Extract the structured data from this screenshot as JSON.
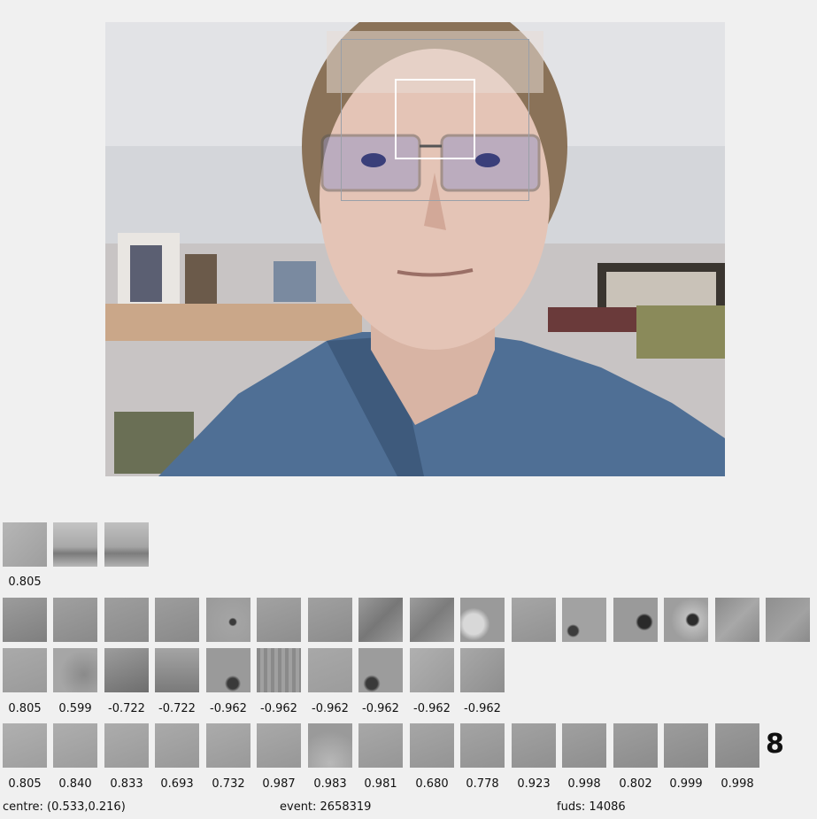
{
  "camera": {
    "label": "webcam view"
  },
  "row_a": {
    "thumbs": [
      {
        "shade": "#a8a8a8",
        "icon": "forehead-patch-icon"
      },
      {
        "shade": "#b8b8b8",
        "icon": "glasses-patch-icon"
      },
      {
        "shade": "#b4b4b4",
        "icon": "glasses-patch-icon"
      }
    ],
    "values": [
      "0.805"
    ]
  },
  "row_b": {
    "thumbs": [
      {
        "shade": "#8e8e8e"
      },
      {
        "shade": "#959595"
      },
      {
        "shade": "#949494"
      },
      {
        "shade": "#939393"
      },
      {
        "shade": "#9a9a9a"
      },
      {
        "shade": "#989898"
      },
      {
        "shade": "#969696"
      },
      {
        "shade": "#8f8f8f"
      },
      {
        "shade": "#929292"
      },
      {
        "shade": "#9b9b9b"
      },
      {
        "shade": "#9d9d9d"
      },
      {
        "shade": "#999999"
      },
      {
        "shade": "#8d8d8d"
      },
      {
        "shade": "#9e9e9e"
      },
      {
        "shade": "#8c8c8c"
      },
      {
        "shade": "#8b8b8b"
      }
    ]
  },
  "row_c": {
    "thumbs": [
      {
        "shade": "#a4a4a4"
      },
      {
        "shade": "#a0a0a0"
      },
      {
        "shade": "#8f8f8f"
      },
      {
        "shade": "#959595"
      },
      {
        "shade": "#909090"
      },
      {
        "shade": "#8a8a8a"
      },
      {
        "shade": "#a2a2a2"
      },
      {
        "shade": "#8c8c8c"
      },
      {
        "shade": "#a6a6a6"
      },
      {
        "shade": "#a3a3a3"
      }
    ],
    "values": [
      "0.805",
      "0.599",
      "-0.722",
      "-0.722",
      "-0.962",
      "-0.962",
      "-0.962",
      "-0.962",
      "-0.962",
      "-0.962"
    ]
  },
  "row_d": {
    "thumbs": [
      {
        "shade": "#a7a7a7"
      },
      {
        "shade": "#a5a5a5"
      },
      {
        "shade": "#a4a4a4"
      },
      {
        "shade": "#a2a2a2"
      },
      {
        "shade": "#a3a3a3"
      },
      {
        "shade": "#a1a1a1"
      },
      {
        "shade": "#a0a0a0"
      },
      {
        "shade": "#9f9f9f"
      },
      {
        "shade": "#9e9e9e"
      },
      {
        "shade": "#9c9c9c"
      },
      {
        "shade": "#9b9b9b"
      },
      {
        "shade": "#9a9a9a"
      },
      {
        "shade": "#999999"
      },
      {
        "shade": "#989898"
      },
      {
        "shade": "#979797"
      }
    ],
    "values": [
      "0.805",
      "0.840",
      "0.833",
      "0.693",
      "0.732",
      "0.987",
      "0.983",
      "0.981",
      "0.680",
      "0.778",
      "0.923",
      "0.998",
      "0.802",
      "0.999",
      "0.998"
    ],
    "count": "8"
  },
  "status": {
    "centre": "centre: (0.533,0.216)",
    "event": "event: 2658319",
    "fuds": "fuds: 14086"
  }
}
